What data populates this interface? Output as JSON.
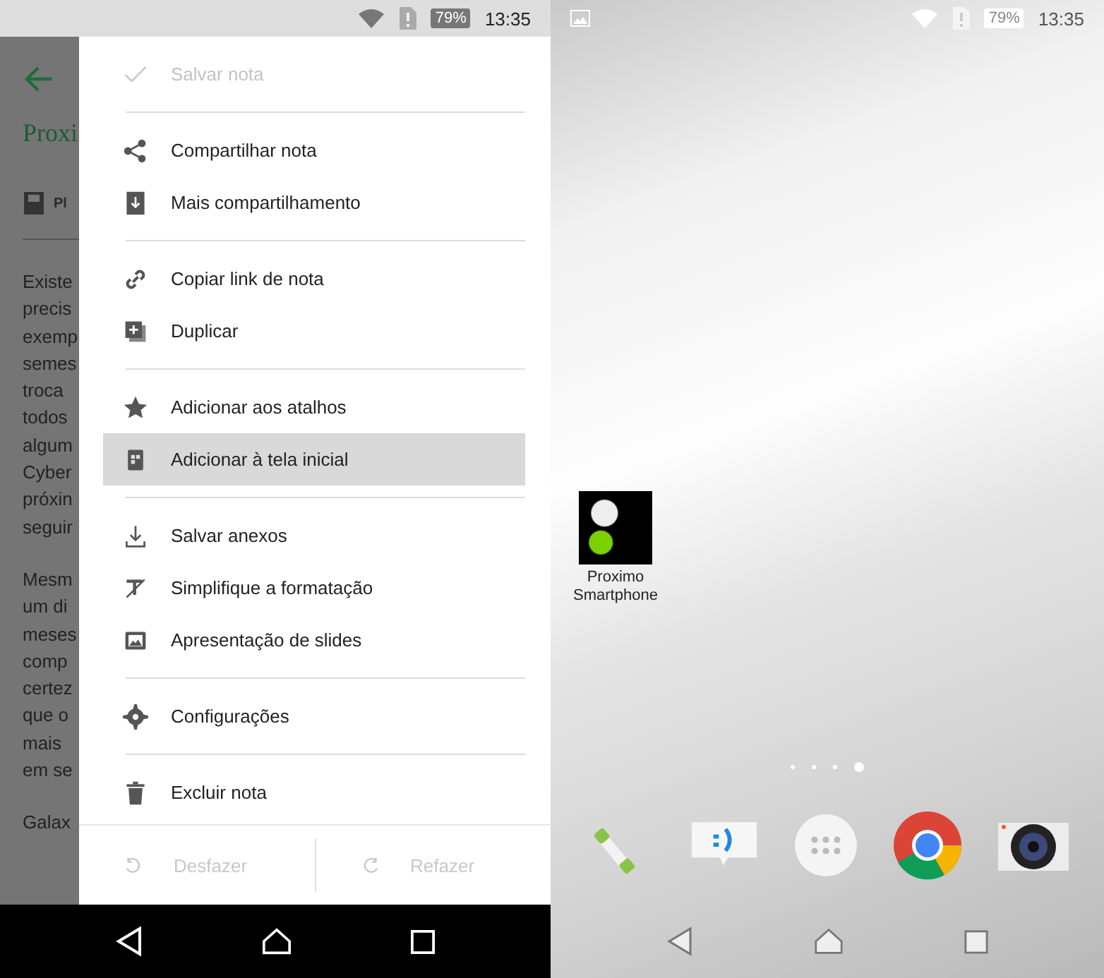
{
  "left_screen": {
    "status_bar": {
      "battery": "79%",
      "time": "13:35"
    },
    "note": {
      "title": "Proxi",
      "attachment_label": "Pl",
      "paragraphs": [
        [
          "Existe",
          "precis",
          "exemp",
          "semes",
          "troca",
          "todos",
          "algum",
          "Cyber",
          "próxin",
          "seguir"
        ],
        [
          "Mesm",
          "um di",
          "meses",
          "comp",
          "certez",
          "que o",
          "mais",
          "em se"
        ],
        [
          "Galax"
        ]
      ]
    },
    "menu": {
      "groups": [
        [
          {
            "label": "Salvar nota",
            "disabled": true,
            "selected": false
          }
        ],
        [
          {
            "label": "Compartilhar nota",
            "disabled": false,
            "selected": false
          },
          {
            "label": "Mais compartilhamento",
            "disabled": false,
            "selected": false
          }
        ],
        [
          {
            "label": "Copiar link de nota",
            "disabled": false,
            "selected": false
          },
          {
            "label": "Duplicar",
            "disabled": false,
            "selected": false
          }
        ],
        [
          {
            "label": "Adicionar aos atalhos",
            "disabled": false,
            "selected": false
          },
          {
            "label": "Adicionar à tela inicial",
            "disabled": false,
            "selected": true
          }
        ],
        [
          {
            "label": "Salvar anexos",
            "disabled": false,
            "selected": false
          },
          {
            "label": "Simplifique a formatação",
            "disabled": false,
            "selected": false
          },
          {
            "label": "Apresentação de slides",
            "disabled": false,
            "selected": false
          }
        ],
        [
          {
            "label": "Configurações",
            "disabled": false,
            "selected": false
          }
        ],
        [
          {
            "label": "Excluir nota",
            "disabled": false,
            "selected": false
          }
        ]
      ],
      "undo": {
        "label": "Desfazer",
        "disabled": true
      },
      "redo": {
        "label": "Refazer",
        "disabled": true
      }
    }
  },
  "right_screen": {
    "status_bar": {
      "battery": "79%",
      "time": "13:35"
    },
    "shortcut": {
      "label": "Proximo Smartphone"
    },
    "page_dots": [
      {
        "selected": false
      },
      {
        "selected": false
      },
      {
        "selected": false
      },
      {
        "selected": true
      }
    ]
  }
}
